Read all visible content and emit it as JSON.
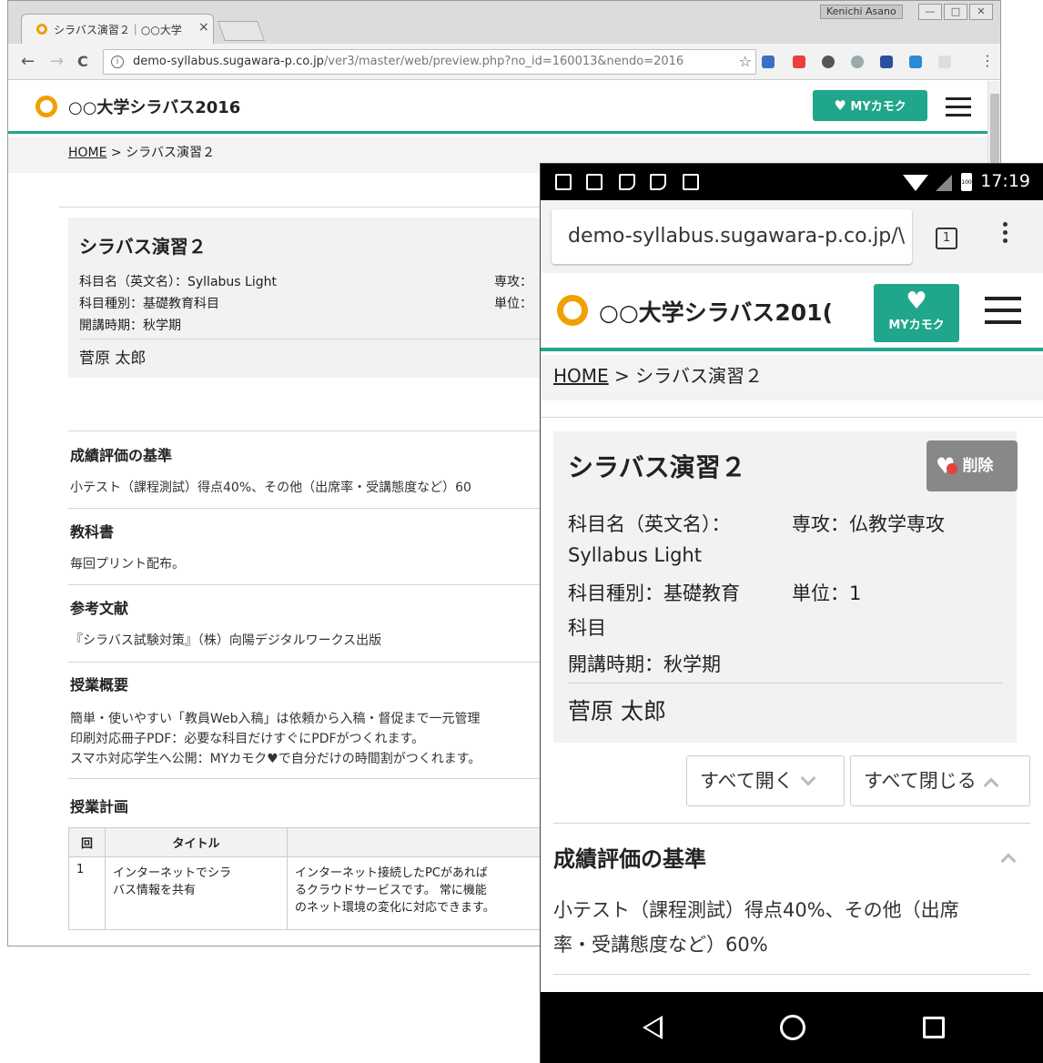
{
  "desktop": {
    "tab_title": "シラバス演習２｜○○大学",
    "tab_close": "×",
    "window_user": "Kenichi Asano",
    "window_buttons": [
      "—",
      "□",
      "✕"
    ],
    "nav": {
      "back": "←",
      "forward": "→",
      "reload": "C"
    },
    "url_domain": "demo-syllabus.sugawara-p.co.jp",
    "url_path": "/ver3/master/web/preview.php?no_id=160013&nendo=2016",
    "site_title": "○○大学シラバス2016",
    "mykamoku_label": "MYカモク",
    "breadcrumb": {
      "home": "HOME",
      "sep": " > ",
      "current": "シラバス演習２"
    },
    "course": {
      "title": "シラバス演習２",
      "en_name": "科目名（英文名）：Syllabus Light",
      "category": "科目種別：基礎教育科目",
      "term": "開講時期：秋学期",
      "major": "専攻：",
      "credit": "単位：",
      "teacher": "菅原 太郎"
    },
    "sections": [
      {
        "head": "成績評価の基準",
        "lines": [
          "小テスト（課程測試）得点40%、その他（出席率・受講態度など）60"
        ]
      },
      {
        "head": "教科書",
        "lines": [
          "毎回プリント配布。"
        ]
      },
      {
        "head": "参考文献",
        "lines": [
          "『シラバス試験対策』（株）向陽デジタルワークス出版"
        ]
      },
      {
        "head": "授業概要",
        "lines": [
          "簡単・使いやすい「教員Web入稿」は依頼から入稿・督促まで一元管理",
          "印刷対応冊子PDF：必要な科目だけすぐにPDFがつくれます。",
          "スマホ対応学生へ公開：MYカモク♥で自分だけの時間割がつくれます。"
        ]
      },
      {
        "head": "授業計画",
        "lines": []
      }
    ],
    "plan_table": {
      "headers": [
        "回",
        "タイトル",
        ""
      ],
      "rows": [
        {
          "no": "1",
          "title_l1": "インターネットでシラ",
          "title_l2": "バス情報を共有",
          "desc_l1": "インターネット接続したPCがあれば",
          "desc_l2": "るクラウドサービスです。 常に機能",
          "desc_l3": "のネット環境の変化に対応できます。"
        }
      ]
    }
  },
  "mobile": {
    "status_time": "17:19",
    "battery": "100",
    "url": "demo-syllabus.sugawara-p.co.jp/\\",
    "tab_count": "1",
    "site_title": "○○大学シラバス201(",
    "mykamoku_label": "MYカモク",
    "breadcrumb": {
      "home": "HOME",
      "sep": " > ",
      "current": "シラバス演習２"
    },
    "course": {
      "title": "シラバス演習２",
      "delete_label": "削除",
      "en_name_l1": "科目名（英文名）：",
      "en_name_l2": "Syllabus Light",
      "major": "専攻：仏教学専攻",
      "category_l1": "科目種別：基礎教育",
      "category_l2": "科目",
      "credit": "単位：1",
      "term": "開講時期：秋学期",
      "teacher": "菅原 太郎"
    },
    "open_all": "すべて開く",
    "close_all": "すべて閉じる",
    "section_head": "成績評価の基準",
    "section_text_l1": "小テスト（課程測試）得点40%、その他（出席",
    "section_text_l2": "率・受講態度など）60%"
  },
  "colors": {
    "accent": "#1fa68b",
    "logo": "#f0a000",
    "delete_btn": "#888888"
  }
}
